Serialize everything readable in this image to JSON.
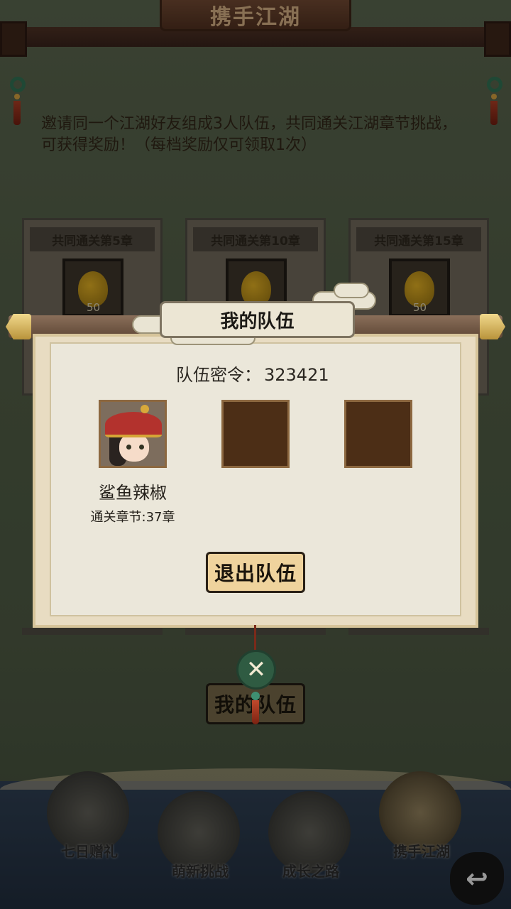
{
  "header": {
    "title": "携手江湖"
  },
  "intro": {
    "text": "邀请同一个江湖好友组成3人队伍，共同通关江湖章节挑战，可获得奖励！（每档奖励仅可领取1次）"
  },
  "reward_cards": [
    {
      "title": "共同通关第5章",
      "item_icon": "gourd-icon",
      "count": "50"
    },
    {
      "title": "共同通关第10章",
      "item_icon": "gourd-icon",
      "count": ""
    },
    {
      "title": "共同通关第15章",
      "item_icon": "gourd-icon",
      "count": "50"
    }
  ],
  "team_modal": {
    "title": "我的队伍",
    "code_label": "队伍密令：",
    "code_value": "323421",
    "member": {
      "name": "鲨鱼辣椒",
      "chapter": "通关章节:37章"
    },
    "exit_label": "退出队伍",
    "close_icon": "close-icon"
  },
  "bg_button": {
    "label": "我的队伍"
  },
  "bottom_menu": [
    {
      "label": "七日赠礼",
      "icon": "gift-box-icon"
    },
    {
      "label": "萌新挑战",
      "icon": "cute-face-icon"
    },
    {
      "label": "成长之路",
      "icon": "book-arrow-icon"
    },
    {
      "label": "携手江湖",
      "icon": "handshake-icon",
      "active": true
    }
  ],
  "back_icon": "back-arrow-icon"
}
